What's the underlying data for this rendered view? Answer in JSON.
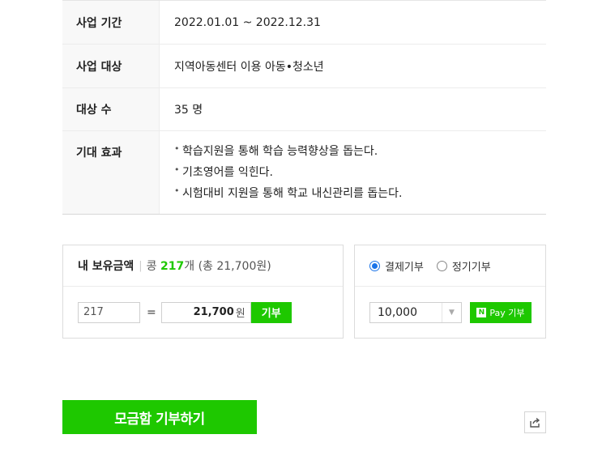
{
  "info": {
    "rows": [
      {
        "label": "사업 기간",
        "value": "2022.01.01 ~ 2022.12.31"
      },
      {
        "label": "사업 대상",
        "value": "지역아동센터 이용 아동•청소년"
      },
      {
        "label": "대상 수",
        "value": "35 명"
      },
      {
        "label": "기대 효과",
        "items": [
          "학습지원을 통해 학습 능력향상을 돕는다.",
          "기초영어를 익힌다.",
          "시험대비 지원을 통해 학교 내신관리를 돕는다."
        ]
      }
    ],
    "bullet": "•"
  },
  "coins": {
    "title": "내 보유금액",
    "separator": "|",
    "prefix": "콩",
    "count": "217",
    "suffix": "개 (총 21,700원)",
    "qty_value": "217",
    "equals": "=",
    "amount": "21,700",
    "amount_unit": "원",
    "donate_label": "기부"
  },
  "payment": {
    "options": [
      {
        "label": "결제기부",
        "selected": true
      },
      {
        "label": "정기기부",
        "selected": false
      }
    ],
    "select_value": "10,000",
    "npay_logo": "N",
    "npay_label": "Pay 기부"
  },
  "actions": {
    "main_label": "모금함 기부하기",
    "share_icon": "share-icon"
  },
  "colors": {
    "accent": "#1ec800",
    "radio": "#1a73e8"
  }
}
